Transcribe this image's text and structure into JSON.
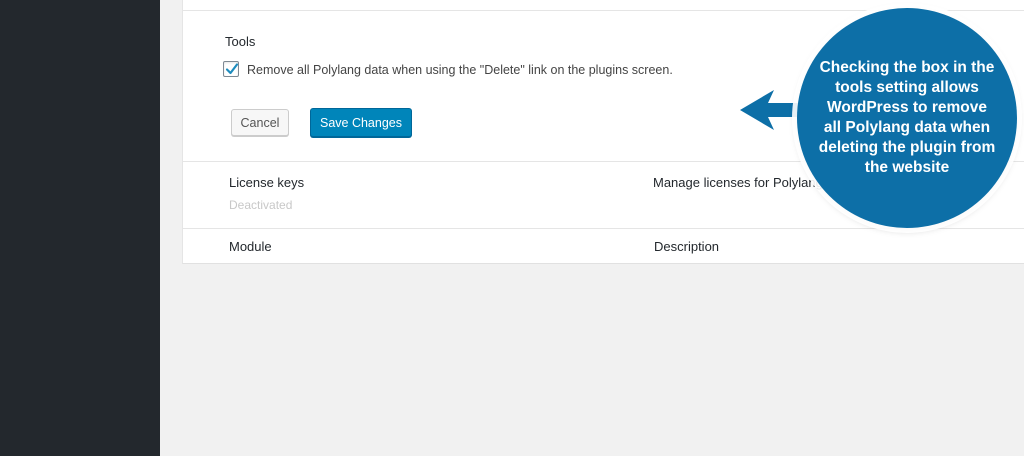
{
  "tools": {
    "heading": "Tools",
    "checkbox_checked": true,
    "checkbox_label": "Remove all Polylang data when using the \"Delete\" link on the plugins screen."
  },
  "buttons": {
    "cancel": "Cancel",
    "save": "Save Changes"
  },
  "license_row": {
    "name": "License keys",
    "status": "Deactivated",
    "description": "Manage licenses for Polylang"
  },
  "table_header": {
    "module": "Module",
    "description": "Description"
  },
  "callout": {
    "text": "Checking the box in the tools setting allows WordPress to remove all Polylang data when deleting the plugin from the website"
  },
  "colors": {
    "sidebar": "#23282d",
    "primary_button": "#0085ba",
    "callout": "#0d6fa7"
  },
  "icons": {
    "checkbox_checkmark": "checkmark-icon",
    "callout_arrow": "arrow-left-icon"
  }
}
